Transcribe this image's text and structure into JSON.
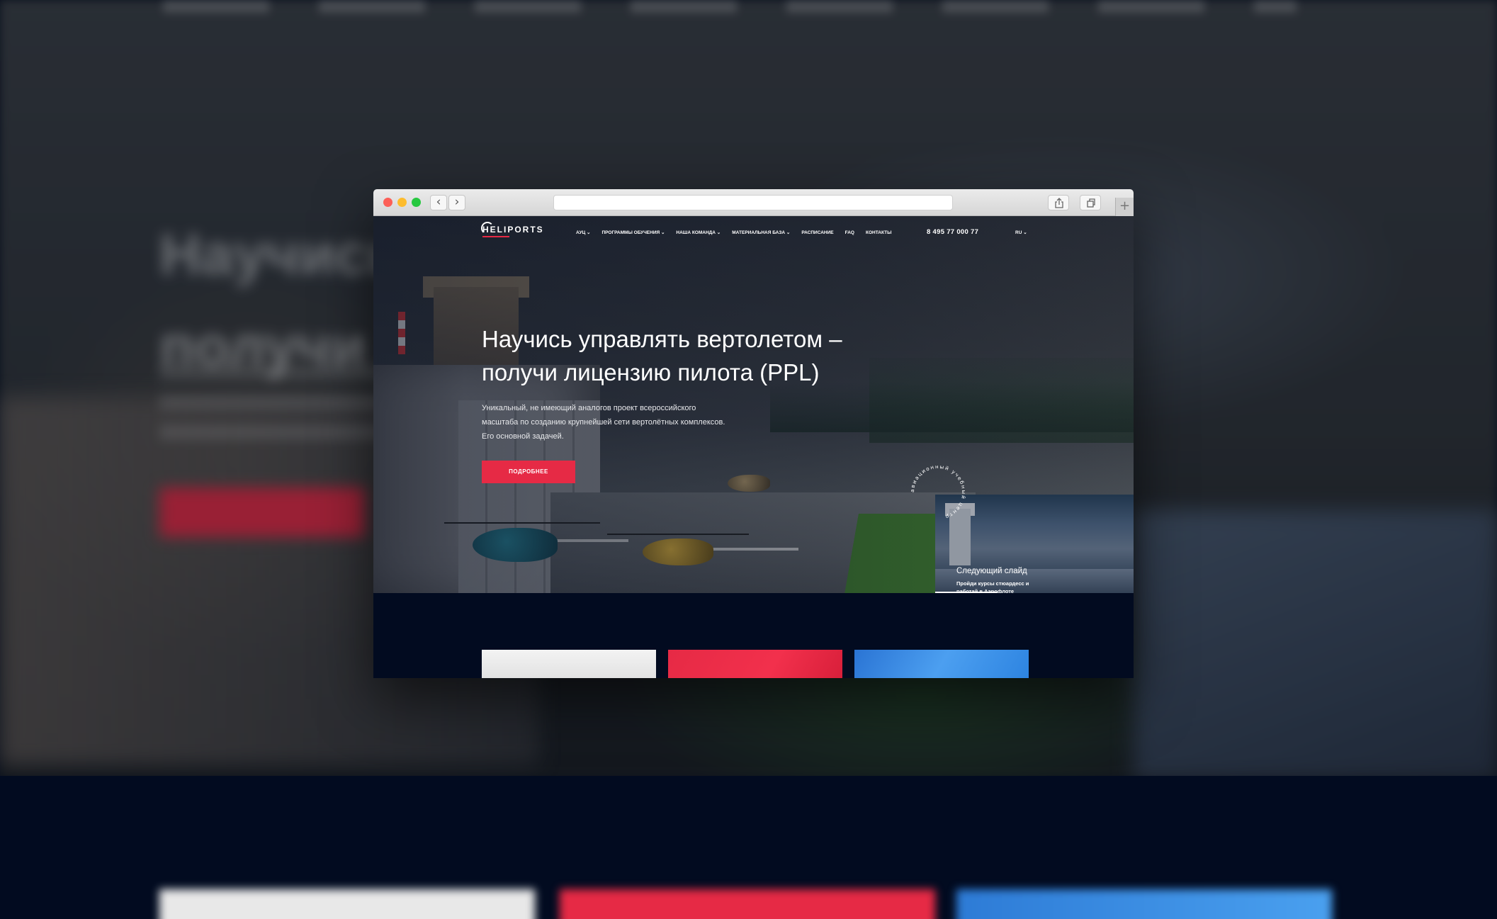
{
  "site": {
    "logo_text": "HELIPORTS",
    "menu": [
      {
        "label": "АУЦ ⌄"
      },
      {
        "label": "ПРОГРАММЫ ОБУЧЕНИЯ ⌄"
      },
      {
        "label": "НАША КОМАНДА ⌄"
      },
      {
        "label": "МАТЕРИАЛЬНАЯ БАЗА ⌄"
      },
      {
        "label": "РАСПИСАНИЕ"
      },
      {
        "label": "FAQ"
      },
      {
        "label": "КОНТАКТЫ"
      }
    ],
    "phone": "8 495 77 000 77",
    "language": "RU ⌄"
  },
  "hero": {
    "title_line1": "Научись управлять вертолетом –",
    "title_line2": "получи лицензию пилота (PPL)",
    "description_line1": "Уникальный, не имеющий аналогов проект всероссийского",
    "description_line2": "масштаба по созданию крупнейшей сети вертолётных комплексов.",
    "description_line3": "Его основной задачей.",
    "cta_label": "ПОДРОБНЕЕ",
    "badge_text": "авиационный учебный центр"
  },
  "next_slide": {
    "label": "Следующий слайд",
    "description": "Пройди курсы стюардесс и работай в Аэрофлоте"
  },
  "colors": {
    "accent": "#e62a45",
    "dark_bg": "#020b20",
    "card_white": "#eeeeee",
    "card_blue": "#3b8fe6"
  },
  "icons": {
    "back": "chevron-left-icon",
    "forward": "chevron-right-icon",
    "share": "share-icon",
    "tabs": "tabs-icon",
    "new_tab": "plus-icon"
  }
}
